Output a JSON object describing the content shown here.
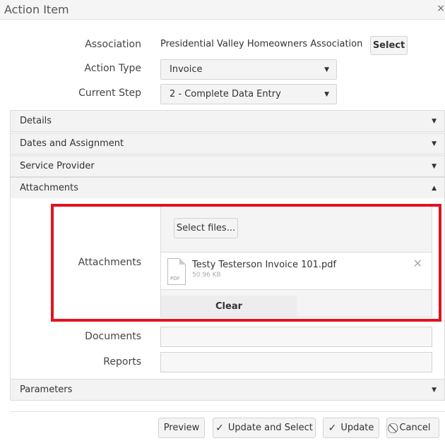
{
  "window": {
    "title": "Action Item",
    "close": "×"
  },
  "form": {
    "association_label": "Association",
    "association_value": "Presidential Valley Homeowners Association",
    "select_button": "Select",
    "action_type_label": "Action Type",
    "action_type_value": "Invoice",
    "current_step_label": "Current Step",
    "current_step_value": "2 - Complete Data Entry"
  },
  "panels": {
    "details": "Details",
    "dates": "Dates and Assignment",
    "provider": "Service Provider",
    "attachments": "Attachments",
    "parameters": "Parameters"
  },
  "attachments": {
    "label": "Attachments",
    "select_files": "Select files...",
    "file_name": "Testy Testerson Invoice 101.pdf",
    "file_size": "50.96 KB",
    "file_ext": "PDF",
    "clear": "Clear"
  },
  "documents_label": "Documents",
  "reports_label": "Reports",
  "footer": {
    "preview": "Preview",
    "update_select": "Update and Select",
    "update": "Update",
    "cancel": "Cancel"
  },
  "colors": {
    "highlight": "#e3131e"
  },
  "icons": {
    "collapsed": "triangle-down-icon",
    "expanded": "triangle-up-icon",
    "check": "check-icon",
    "cancel": "cancel-circle-icon",
    "remove": "x-icon",
    "file": "pdf-file-icon"
  }
}
